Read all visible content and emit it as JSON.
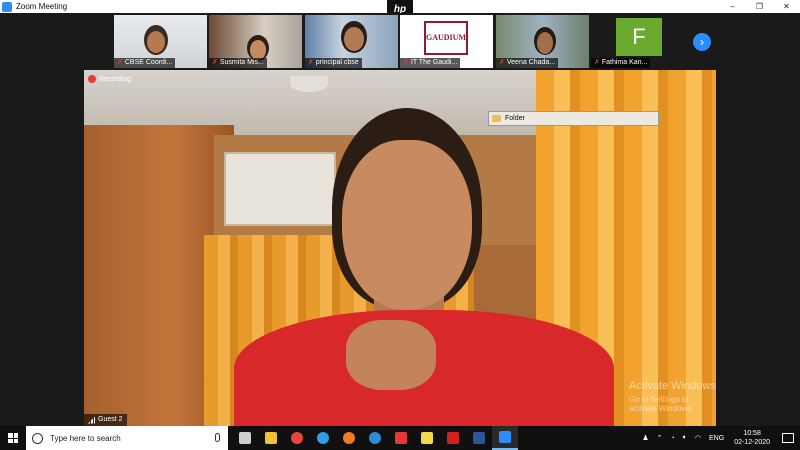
{
  "window": {
    "title": "Zoom Meeting",
    "controls": [
      "–",
      "❐",
      "✕"
    ],
    "laptop_brand": "hp"
  },
  "participants_strip": {
    "items": [
      {
        "name": "CBSE Coordi...",
        "muted": true
      },
      {
        "name": "Susmita Mis...",
        "muted": true
      },
      {
        "name": "principal cbse",
        "muted": true
      },
      {
        "name": "IT The Gaudi...",
        "muted": true,
        "logo_text": "GAUDIUM"
      },
      {
        "name": "Veena Chada...",
        "muted": true
      },
      {
        "name": "Fathima Kan...",
        "muted": true,
        "avatar_letter": "F"
      }
    ],
    "next_arrow": "›"
  },
  "main_video": {
    "recording_label": "Recording",
    "speaker_label": "Guest 2"
  },
  "tooltip": {
    "label": "Folder"
  },
  "watermark": {
    "title": "Activate Windows",
    "subtitle": "Go to Settings to activate Windows."
  },
  "taskbar": {
    "search_placeholder": "Type here to search",
    "apps": [
      {
        "icon": "task-view-icon",
        "color": "#cfcfcf"
      },
      {
        "icon": "file-explorer-icon",
        "color": "#f1c232"
      },
      {
        "icon": "chrome-icon",
        "color": "#e8453c"
      },
      {
        "icon": "edge-icon",
        "color": "#2f9ee6"
      },
      {
        "icon": "firefox-icon",
        "color": "#f07b24"
      },
      {
        "icon": "ie-icon",
        "color": "#2c8ed6"
      },
      {
        "icon": "anydesk-icon",
        "color": "#e53935"
      },
      {
        "icon": "sticky-notes-icon",
        "color": "#f6d84b"
      },
      {
        "icon": "acrobat-icon",
        "color": "#d3201c"
      },
      {
        "icon": "word-icon",
        "color": "#2b5797"
      },
      {
        "icon": "zoom-icon",
        "color": "#2d8cff"
      }
    ],
    "language": "ENG",
    "time": "10:58",
    "date": "02-12-2020"
  },
  "colors": {
    "accent": "#2d8cff",
    "muted_mic": "#e03b3b",
    "recording_dot": "#e23c3c"
  }
}
